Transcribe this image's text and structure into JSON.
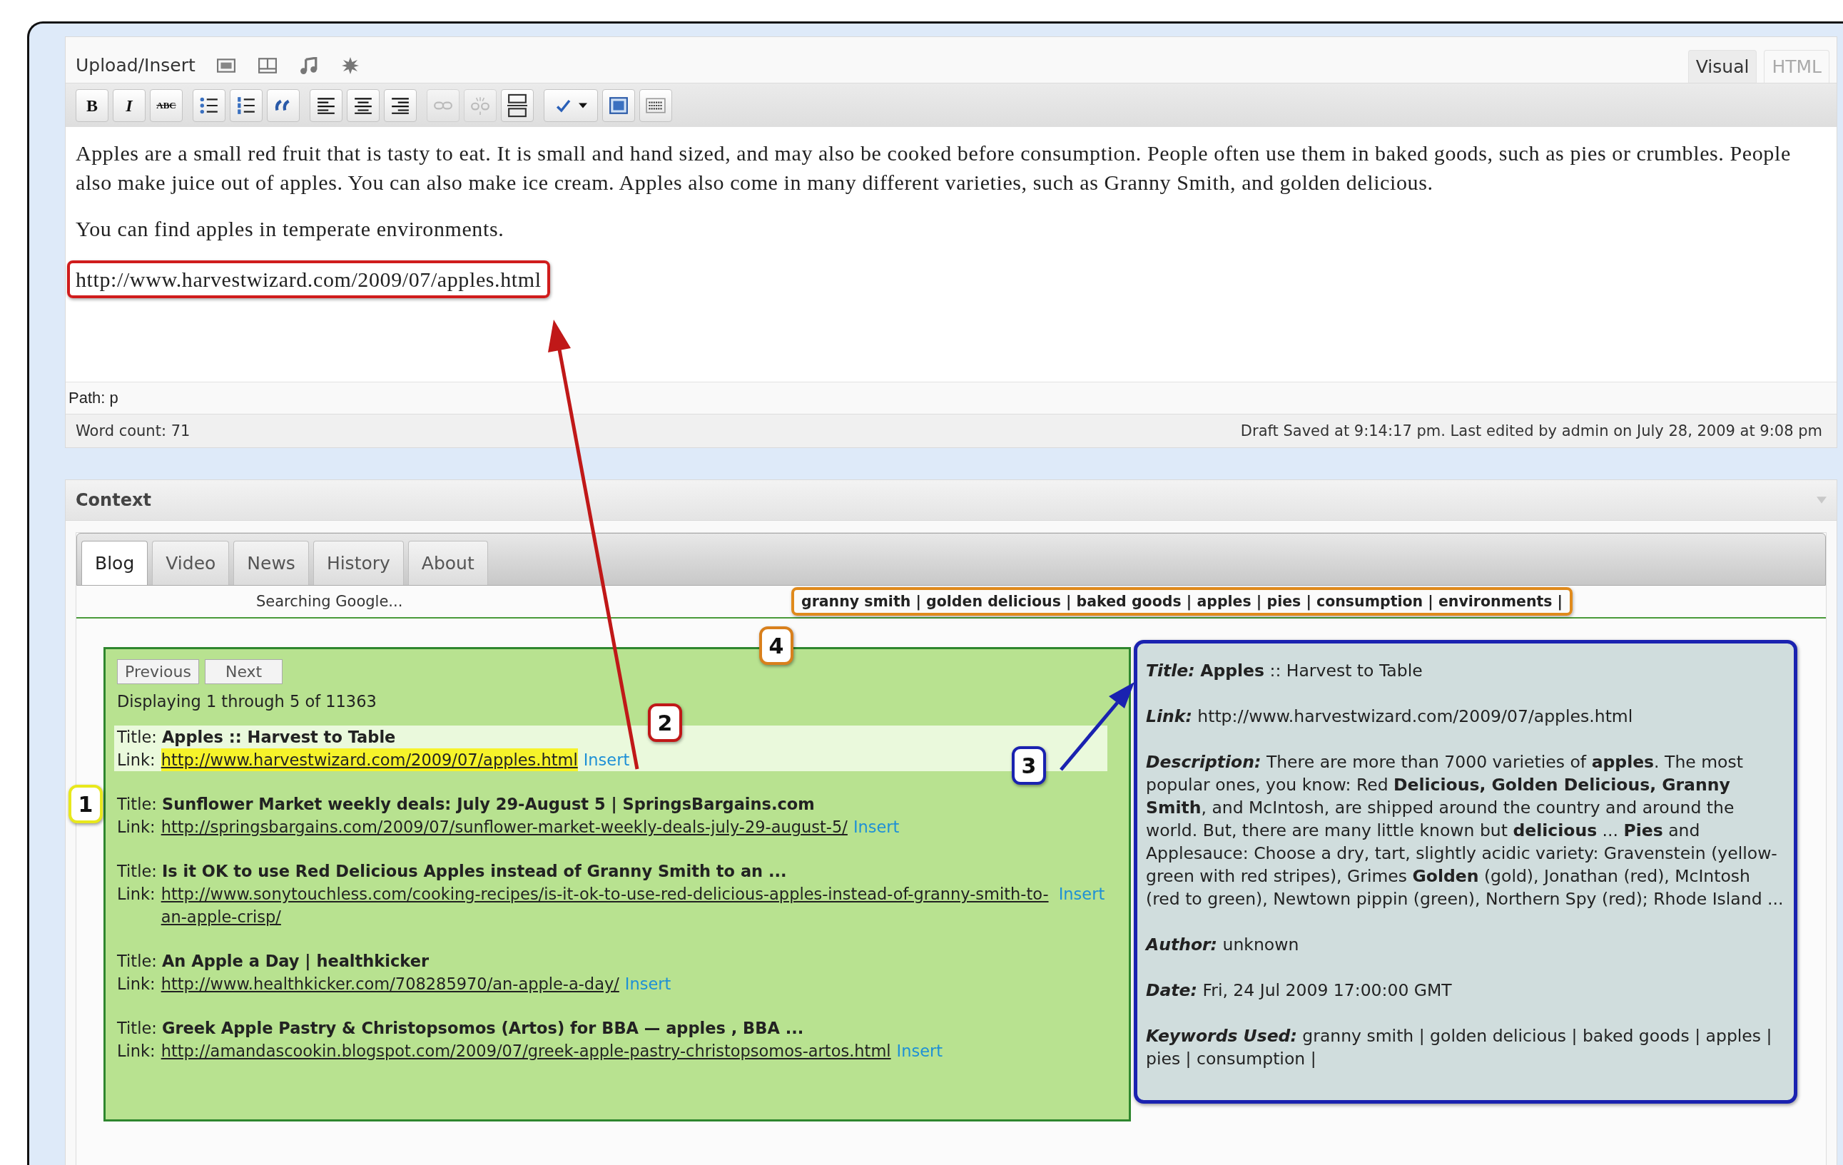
{
  "media_bar": {
    "label": "Upload/Insert"
  },
  "editor_tabs": [
    {
      "label": "Visual",
      "selected": true
    },
    {
      "label": "HTML",
      "selected": false
    }
  ],
  "toolbar": [
    {
      "buttons": [
        {
          "kind": "bold",
          "label": "B",
          "disabled": false
        },
        {
          "kind": "italic",
          "label": "I",
          "disabled": false
        },
        {
          "kind": "strikethrough",
          "label": "ABC",
          "disabled": false
        }
      ]
    },
    {
      "buttons": [
        {
          "kind": "bullet-list",
          "disabled": false
        },
        {
          "kind": "numbered-list",
          "disabled": false
        },
        {
          "kind": "blockquote",
          "disabled": false
        }
      ]
    },
    {
      "buttons": [
        {
          "kind": "align-left",
          "disabled": false
        },
        {
          "kind": "align-center",
          "disabled": false
        },
        {
          "kind": "align-right",
          "disabled": false
        }
      ]
    },
    {
      "buttons": [
        {
          "kind": "link",
          "disabled": true
        },
        {
          "kind": "unlink",
          "disabled": true
        },
        {
          "kind": "more",
          "disabled": false
        }
      ]
    },
    {
      "buttons": [
        {
          "kind": "spellcheck",
          "disabled": false
        },
        {
          "kind": "fullscreen",
          "disabled": false
        },
        {
          "kind": "kitchen-sink",
          "disabled": false
        }
      ]
    }
  ],
  "content": {
    "paragraphs": [
      "Apples are a small red fruit that is tasty to eat. It is small and hand sized, and may also be cooked before consumption. People often use them in baked goods, such as pies or crumbles. People also make juice out of apples. You can also make ice cream. Apples also come in many different varieties, such as Granny Smith, and golden delicious.",
      "You can find apples in temperate environments."
    ],
    "inserted_link": "http://www.harvestwizard.com/2009/07/apples.html"
  },
  "path": "Path: p",
  "word_count": "Word count: 71",
  "draft_status": "Draft Saved at 9:14:17 pm. Last edited by admin on July 28, 2009 at 9:08 pm",
  "context": {
    "title": "Context",
    "tabs": [
      {
        "label": "Blog",
        "selected": true
      },
      {
        "label": "Video",
        "selected": false
      },
      {
        "label": "News",
        "selected": false
      },
      {
        "label": "History",
        "selected": false
      },
      {
        "label": "About",
        "selected": false
      }
    ],
    "status": "Searching Google...",
    "keywords": "granny smith | golden delicious | baked goods | apples | pies | consumption | environments |",
    "pager": {
      "previous": "Previous",
      "next": "Next",
      "summary": "Displaying 1 through 5 of 11363"
    },
    "results": [
      {
        "title_label": "Title:",
        "title": "Apples :: Harvest to Table",
        "link_label": "Link:",
        "link": "http://www.harvestwizard.com/2009/07/apples.html",
        "action": "Insert",
        "selected": true
      },
      {
        "title_label": "Title:",
        "title": "Sunflower Market weekly deals: July 29-August 5 | SpringsBargains.com",
        "link_label": "Link:",
        "link": "http://springsbargains.com/2009/07/sunflower-market-weekly-deals-july-29-august-5/",
        "action": "Insert",
        "selected": false
      },
      {
        "title_label": "Title:",
        "title": "Is it OK to use Red Delicious Apples instead of Granny Smith to an ...",
        "link_label": "Link:",
        "link": "http://www.sonytouchless.com/cooking-recipes/is-it-ok-to-use-red-delicious-apples-instead-of-granny-smith-to-an-apple-crisp/",
        "action": "Insert",
        "selected": false
      },
      {
        "title_label": "Title:",
        "title": "An Apple a Day | healthkicker",
        "link_label": "Link:",
        "link": "http://www.healthkicker.com/708285970/an-apple-a-day/",
        "action": "Insert",
        "selected": false
      },
      {
        "title_label": "Title:",
        "title": "Greek Apple Pastry & Christopsomos (Artos) for BBA — apples , BBA ...",
        "link_label": "Link:",
        "link": "http://amandascookin.blogspot.com/2009/07/greek-apple-pastry-christopsomos-artos.html",
        "action": "Insert",
        "selected": false
      }
    ],
    "details": [
      {
        "label": "Title:",
        "value": "**Apples** :: Harvest to Table"
      },
      {
        "label": "Link:",
        "value": "http://www.harvestwizard.com/2009/07/apples.html"
      },
      {
        "label": "Description:",
        "value": "There are more than 7000 varieties of **apples**. The most popular ones, you know: Red **Delicious, Golden Delicious, Granny Smith**, and McIntosh, are shipped around the country and around the world. But, there are many little known but **delicious** ... **Pies** and Applesauce: Choose a dry, tart, slightly acidic variety: Gravenstein (yellow-green with red stripes), Grimes **Golden** (gold), Jonathan (red), McIntosh (red to green), Newtown pippin (green), Northern Spy (red); Rhode Island ..."
      },
      {
        "label": "Author:",
        "value": "unknown"
      },
      {
        "label": "Date:",
        "value": "Fri, 24 Jul 2009 17:00:00 GMT"
      },
      {
        "label": "Keywords Used:",
        "value": "granny smith | golden delicious | baked goods | apples | pies | consumption |"
      }
    ]
  },
  "callouts": [
    {
      "number": "1",
      "color": "#e8e81c"
    },
    {
      "number": "2",
      "color": "#c01818"
    },
    {
      "number": "3",
      "color": "#1a22b0"
    },
    {
      "number": "4",
      "color": "#d9801c"
    }
  ]
}
